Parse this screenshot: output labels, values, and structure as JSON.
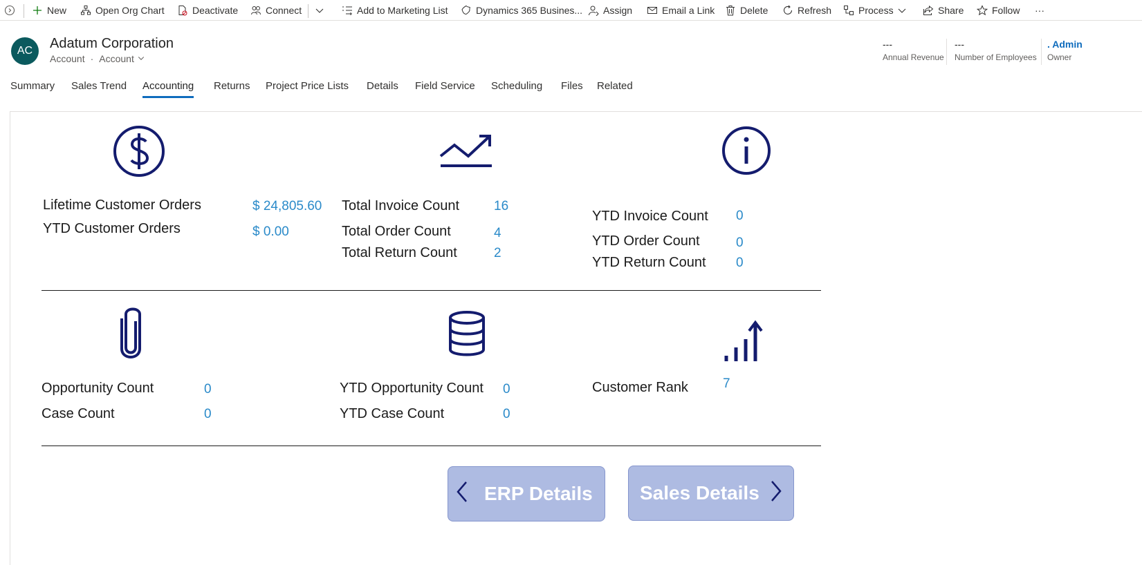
{
  "command_bar": {
    "new": "New",
    "open_org_chart": "Open Org Chart",
    "deactivate": "Deactivate",
    "connect": "Connect",
    "add_to_marketing_list": "Add to Marketing List",
    "dynamics_365": "Dynamics 365 Busines...",
    "assign": "Assign",
    "email_link": "Email a Link",
    "delete": "Delete",
    "refresh": "Refresh",
    "process": "Process",
    "share": "Share",
    "follow": "Follow",
    "more": "···"
  },
  "record": {
    "initials": "AC",
    "title": "Adatum Corporation",
    "entity": "Account",
    "form": "Account"
  },
  "header_fields": [
    {
      "value": "---",
      "label": "Annual Revenue"
    },
    {
      "value": "---",
      "label": "Number of Employees"
    },
    {
      "value": ". Admin",
      "label": "Owner"
    }
  ],
  "tabs": [
    "Summary",
    "Sales Trend",
    "Accounting",
    "Returns",
    "Project Price Lists",
    "Details",
    "Field Service",
    "Scheduling",
    "Files",
    "Related"
  ],
  "active_tab": "Accounting",
  "metrics": {
    "lifetime_orders_label": "Lifetime Customer Orders",
    "lifetime_orders_value": "$ 24,805.60",
    "ytd_orders_label": "YTD Customer Orders",
    "ytd_orders_value": "$ 0.00",
    "total_invoice_label": "Total Invoice Count",
    "total_invoice_value": "16",
    "total_order_label": "Total Order Count",
    "total_order_value": "4",
    "total_return_label": "Total Return Count",
    "total_return_value": "2",
    "ytd_invoice_label": "YTD Invoice Count",
    "ytd_invoice_value": "0",
    "ytd_order_label": "YTD Order Count",
    "ytd_order_value": "0",
    "ytd_return_label": "YTD Return Count",
    "ytd_return_value": "0",
    "opportunity_label": "Opportunity Count",
    "opportunity_value": "0",
    "case_label": "Case Count",
    "case_value": "0",
    "ytd_opportunity_label": "YTD Opportunity Count",
    "ytd_opportunity_value": "0",
    "ytd_case_label": "YTD Case Count",
    "ytd_case_value": "0",
    "customer_rank_label": "Customer Rank",
    "customer_rank_value": "7"
  },
  "buttons": {
    "erp_details": "ERP Details",
    "sales_details": "Sales Details"
  },
  "icons": {
    "section1": [
      "dollar-icon",
      "trend-up-icon",
      "info-icon"
    ],
    "section2": [
      "paperclip-icon",
      "database-icon",
      "rank-bars-icon"
    ]
  },
  "colors": {
    "icon_navy": "#141c6e",
    "value_blue": "#2a8ac9",
    "tab_underline": "#0f6cbd",
    "avatar_bg": "#0b5a5e",
    "nav_button_bg": "#aebbe2",
    "owner_link": "#0f6cbd"
  }
}
